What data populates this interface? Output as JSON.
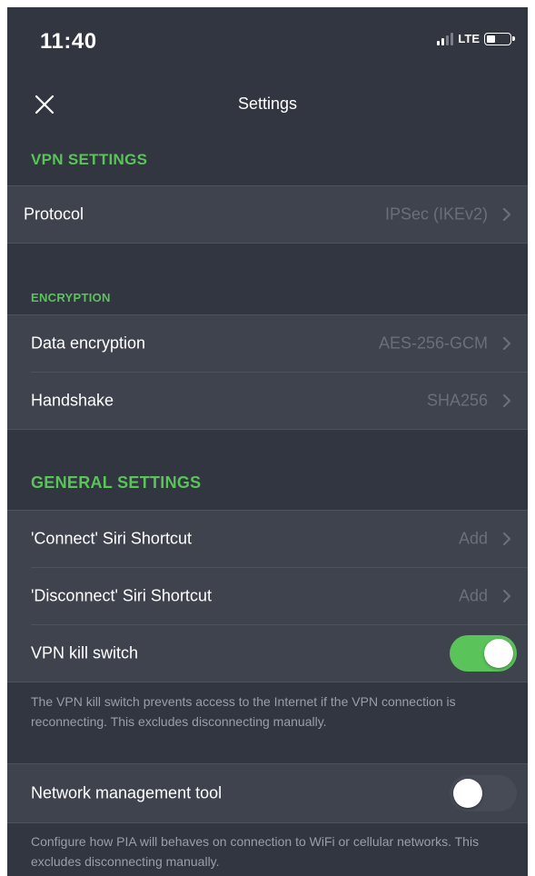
{
  "status_bar": {
    "time": "11:40",
    "network": "LTE"
  },
  "nav": {
    "title": "Settings",
    "close_icon": "close-icon"
  },
  "vpn_settings": {
    "header": "VPN SETTINGS",
    "protocol": {
      "label": "Protocol",
      "value": "IPSec (IKEv2)"
    }
  },
  "encryption": {
    "header": "ENCRYPTION",
    "data_encryption": {
      "label": "Data encryption",
      "value": "AES-256-GCM"
    },
    "handshake": {
      "label": "Handshake",
      "value": "SHA256"
    }
  },
  "general_settings": {
    "header": "GENERAL SETTINGS",
    "connect_shortcut": {
      "label": "'Connect' Siri Shortcut",
      "value": "Add"
    },
    "disconnect_shortcut": {
      "label": "'Disconnect' Siri Shortcut",
      "value": "Add"
    },
    "kill_switch": {
      "label": "VPN kill switch",
      "enabled": true,
      "description": "The VPN kill switch prevents access to the Internet if the VPN connection is reconnecting. This excludes disconnecting manually."
    },
    "network_tool": {
      "label": "Network management tool",
      "enabled": false,
      "description": "Configure how PIA will behaves on connection to WiFi or cellular networks. This excludes disconnecting manually."
    }
  },
  "colors": {
    "background": "#323640",
    "row_background": "#3e434d",
    "accent_green": "#5ac35a",
    "secondary_text": "#6a6f79"
  }
}
